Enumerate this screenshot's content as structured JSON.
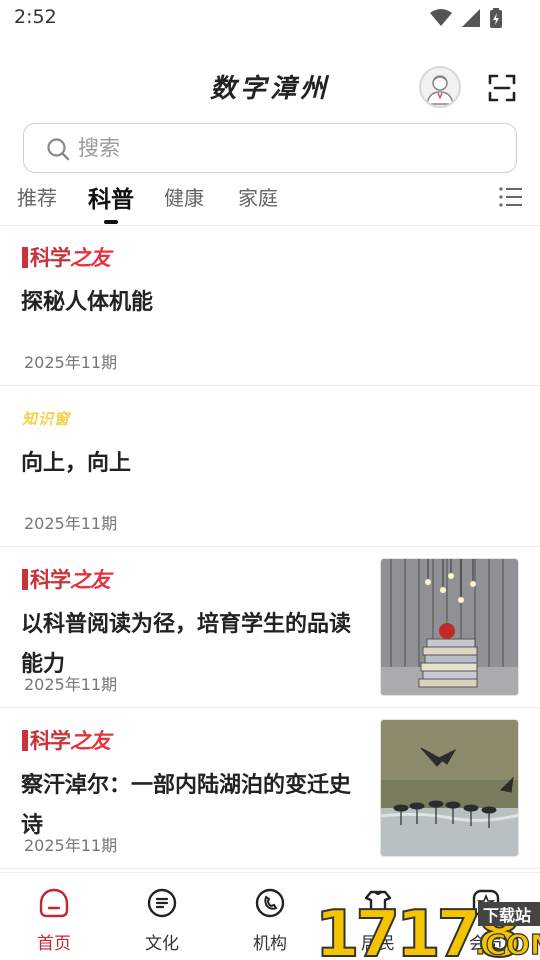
{
  "status_bar": {
    "time": "2:52",
    "icons": [
      "wifi-icon",
      "signal-icon",
      "battery-icon"
    ]
  },
  "header": {
    "title": "数字漳州",
    "avatar_icon": "avatar-icon",
    "scan_icon": "scan-icon"
  },
  "search": {
    "placeholder": "搜索",
    "value": ""
  },
  "tabs": {
    "items": [
      {
        "label": "推荐",
        "active": false
      },
      {
        "label": "科普",
        "active": true
      },
      {
        "label": "健康",
        "active": false
      },
      {
        "label": "家庭",
        "active": false
      }
    ],
    "menu_icon": "list-menu-icon"
  },
  "articles": [
    {
      "brand": "科学之友",
      "brand_type": "kexue",
      "title": "探秘人体机能",
      "issue": "2025年11期",
      "thumb": null
    },
    {
      "brand": "知识窗",
      "brand_type": "zhishi",
      "title": "向上，向上",
      "issue": "2025年11期",
      "thumb": null
    },
    {
      "brand": "科学之友",
      "brand_type": "kexue",
      "title": "以科普阅读为径，培育学生的品读能力",
      "issue": "2025年11期",
      "thumb": "books-apple-photo"
    },
    {
      "brand": "科学之友",
      "brand_type": "kexue",
      "title": "察汗淖尔：一部内陆湖泊的变迁史诗",
      "issue": "2025年11期",
      "thumb": "cranes-lake-photo"
    }
  ],
  "bottom_nav": {
    "items": [
      {
        "label": "首页",
        "icon": "home-icon",
        "active": true
      },
      {
        "label": "文化",
        "icon": "culture-icon",
        "active": false
      },
      {
        "label": "机构",
        "icon": "phone-icon",
        "active": false
      },
      {
        "label": "居民",
        "icon": "resident-icon",
        "active": false
      },
      {
        "label": "会员",
        "icon": "member-icon",
        "active": false
      }
    ]
  },
  "watermark": {
    "site_number": "17178",
    "site_suffix": ".COM",
    "download_label": "下载站"
  },
  "colors": {
    "accent_red": "#c0282f",
    "brand_red": "#e5333f",
    "brand_yellow": "#f3d24a",
    "watermark_yellow": "#f5c400"
  }
}
